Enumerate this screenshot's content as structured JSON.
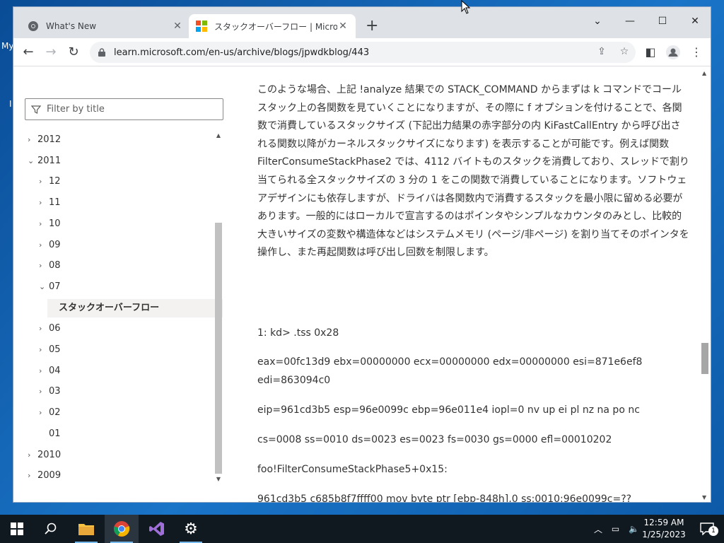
{
  "desktop": {
    "label1": "My",
    "label2": "I"
  },
  "browser": {
    "tabs": [
      {
        "title": "What's New",
        "active": false
      },
      {
        "title": "スタックオーバーフロー | Microsoft Lea",
        "active": true
      }
    ],
    "new_tab": "+",
    "address": "learn.microsoft.com/en-us/archive/blogs/jpwdkblog/443"
  },
  "sidebar": {
    "filter_placeholder": "Filter by title",
    "tree": [
      {
        "label": "2012",
        "level": 0,
        "chevron": "right"
      },
      {
        "label": "2011",
        "level": 0,
        "chevron": "down"
      },
      {
        "label": "12",
        "level": 1,
        "chevron": "right"
      },
      {
        "label": "11",
        "level": 1,
        "chevron": "right"
      },
      {
        "label": "10",
        "level": 1,
        "chevron": "right"
      },
      {
        "label": "09",
        "level": 1,
        "chevron": "right"
      },
      {
        "label": "08",
        "level": 1,
        "chevron": "right"
      },
      {
        "label": "07",
        "level": 1,
        "chevron": "down"
      },
      {
        "label": "スタックオーバーフロー",
        "level": 2,
        "chevron": "none",
        "selected": true
      },
      {
        "label": "06",
        "level": 1,
        "chevron": "right"
      },
      {
        "label": "05",
        "level": 1,
        "chevron": "right"
      },
      {
        "label": "04",
        "level": 1,
        "chevron": "right"
      },
      {
        "label": "03",
        "level": 1,
        "chevron": "right"
      },
      {
        "label": "02",
        "level": 1,
        "chevron": "right"
      },
      {
        "label": "01",
        "level": 1,
        "chevron": "none"
      },
      {
        "label": "2010",
        "level": 0,
        "chevron": "right"
      },
      {
        "label": "2009",
        "level": 0,
        "chevron": "right"
      }
    ]
  },
  "article": {
    "paragraph": "このような場合、上記 !analyze 結果での STACK_COMMAND からまずは k コマンドでコールスタック上の各関数を見ていくことになりますが、その際に f オプションを付けることで、各関数で消費しているスタックサイズ (下記出力結果の赤字部分の内 KiFastCallEntry から呼び出される関数以降がカーネルスタックサイズになります) を表示することが可能です。例えば関数 FilterConsumeStackPhase2 では、4112 バイトものスタックを消費しており、スレッドで割り当てられる全スタックサイズの 3 分の 1 をこの関数で消費していることになります。ソフトウェアデザインにも依存しますが、ドライバは各関数内で消費するスタックを最小限に留める必要があります。一般的にはローカルで宣言するのはポインタやシンプルなカウンタのみとし、比較的大きいサイズの変数や構造体などはシステムメモリ (ページ/非ページ) を割り当てそのポインタを操作し、また再起関数は呼び出し回数を制限します。",
    "code": [
      "1: kd> .tss 0x28",
      "eax=00fc13d9 ebx=00000000 ecx=00000000 edx=00000000 esi=871e6ef8",
      "edi=863094c0",
      "eip=961cd3b5 esp=96e0099c ebp=96e011e4 iopl=0 nv up ei pl nz na po nc",
      "cs=0008 ss=0010 ds=0023 es=0023 fs=0030 gs=0000 efl=00010202",
      "foo!FilterConsumeStackPhase5+0x15:",
      "961cd3b5 c685b8f7ffff00 mov byte ptr [ebp-848h],0 ss:0010:96e0099c=??"
    ]
  },
  "taskbar": {
    "time": "12:59 AM",
    "date": "1/25/2023",
    "notification_count": "1"
  }
}
